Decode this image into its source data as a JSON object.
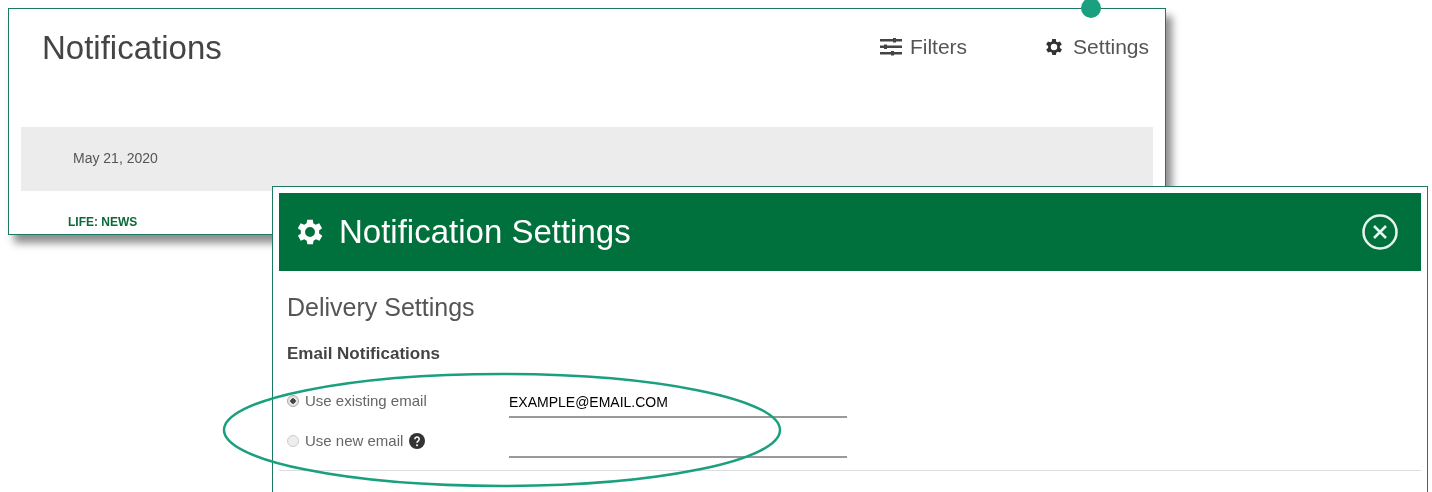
{
  "notifications_window": {
    "title": "Notifications",
    "toolbar": [
      {
        "kind": "filters",
        "label": "Filters"
      },
      {
        "kind": "settings",
        "label": "Settings"
      }
    ],
    "date_header": "May 21, 2020",
    "category": "LIFE: NEWS"
  },
  "settings_dialog": {
    "title": "Notification Settings",
    "section": "Delivery Settings",
    "group": "Email Notifications",
    "options": [
      {
        "label": "Use existing email",
        "selected": true,
        "value": "EXAMPLE@EMAIL.COM",
        "help": false
      },
      {
        "label": "Use new email",
        "selected": false,
        "help": true
      }
    ]
  }
}
